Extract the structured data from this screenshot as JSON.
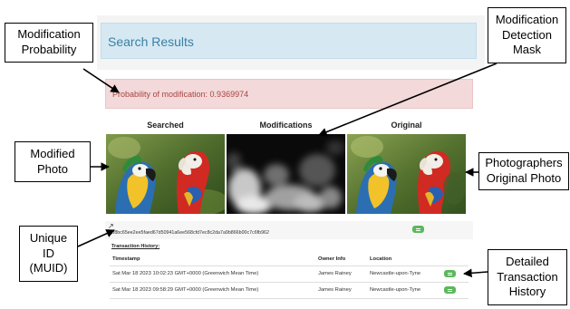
{
  "search": {
    "title": "Search Results"
  },
  "alert": {
    "text": "Probability of modification: 0.9369974"
  },
  "columns": {
    "searched": "Searched",
    "modifications": "Modifications",
    "original": "Original"
  },
  "callouts": {
    "probability": [
      "Modification",
      "Probability"
    ],
    "mask": [
      "Modification",
      "Detection",
      "Mask"
    ],
    "modified_photo": [
      "Modified",
      "Photo"
    ],
    "original_photo": [
      "Photographers",
      "Original Photo"
    ],
    "muid": [
      "Unique",
      "ID",
      "(MUID)"
    ],
    "history": [
      "Detailed",
      "Transaction",
      "History"
    ]
  },
  "muid": {
    "value": "42f8bc65ee2ee5faed67d50941a6ee568cfd7ec8c2da7a9b866b00c7c6fb962",
    "icon": "external-link-icon"
  },
  "transactions": {
    "title": "Transaction History:",
    "headers": {
      "timestamp": "Timestamp",
      "owner": "Owner Info",
      "location": "Location"
    },
    "rows": [
      {
        "timestamp": "Sat Mar 18 2023 10:02:23 GMT+0000 (Greenwich Mean Time)",
        "owner": "James Rainey",
        "location": "Newcastle-upon-Tyne"
      },
      {
        "timestamp": "Sat Mar 18 2023 09:58:29 GMT+0000 (Greenwich Mean Time)",
        "owner": "James Rainey",
        "location": "Newcastle-upon-Tyne"
      }
    ]
  },
  "colors": {
    "header_bg": "#d6e9f3",
    "header_text": "#3a7fa6",
    "alert_bg": "#f3d9da",
    "alert_text": "#a94442",
    "button_green": "#5cb85c"
  }
}
